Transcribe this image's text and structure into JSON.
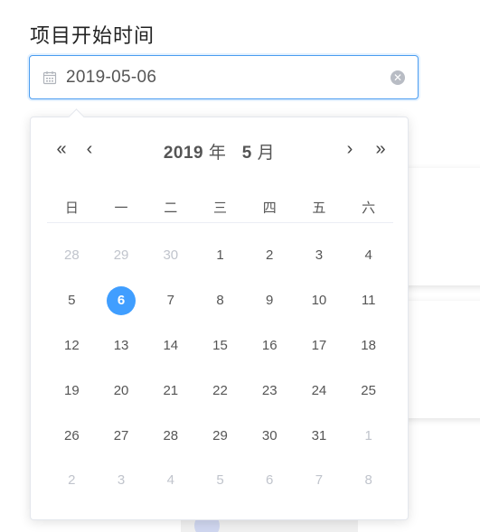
{
  "field": {
    "label": "项目开始时间",
    "value": "2019-05-06"
  },
  "calendar": {
    "year": "2019",
    "year_suffix": "年",
    "month": "5",
    "month_suffix": "月",
    "nav": {
      "prev_year": "«",
      "prev_month": "‹",
      "next_month": "›",
      "next_year": "»"
    },
    "weekdays": [
      "日",
      "一",
      "二",
      "三",
      "四",
      "五",
      "六"
    ],
    "days": [
      {
        "d": "28",
        "other": true
      },
      {
        "d": "29",
        "other": true
      },
      {
        "d": "30",
        "other": true
      },
      {
        "d": "1"
      },
      {
        "d": "2"
      },
      {
        "d": "3"
      },
      {
        "d": "4"
      },
      {
        "d": "5"
      },
      {
        "d": "6",
        "selected": true
      },
      {
        "d": "7"
      },
      {
        "d": "8"
      },
      {
        "d": "9"
      },
      {
        "d": "10"
      },
      {
        "d": "11"
      },
      {
        "d": "12"
      },
      {
        "d": "13"
      },
      {
        "d": "14"
      },
      {
        "d": "15"
      },
      {
        "d": "16"
      },
      {
        "d": "17"
      },
      {
        "d": "18"
      },
      {
        "d": "19"
      },
      {
        "d": "20"
      },
      {
        "d": "21"
      },
      {
        "d": "22"
      },
      {
        "d": "23"
      },
      {
        "d": "24"
      },
      {
        "d": "25"
      },
      {
        "d": "26"
      },
      {
        "d": "27"
      },
      {
        "d": "28"
      },
      {
        "d": "29"
      },
      {
        "d": "30"
      },
      {
        "d": "31"
      },
      {
        "d": "1",
        "other": true
      },
      {
        "d": "2",
        "other": true
      },
      {
        "d": "3",
        "other": true
      },
      {
        "d": "4",
        "other": true
      },
      {
        "d": "5",
        "other": true
      },
      {
        "d": "6",
        "other": true
      },
      {
        "d": "7",
        "other": true
      },
      {
        "d": "8",
        "other": true
      }
    ]
  },
  "colors": {
    "accent": "#409eff",
    "muted": "#c0c4cc",
    "text": "#555555"
  }
}
